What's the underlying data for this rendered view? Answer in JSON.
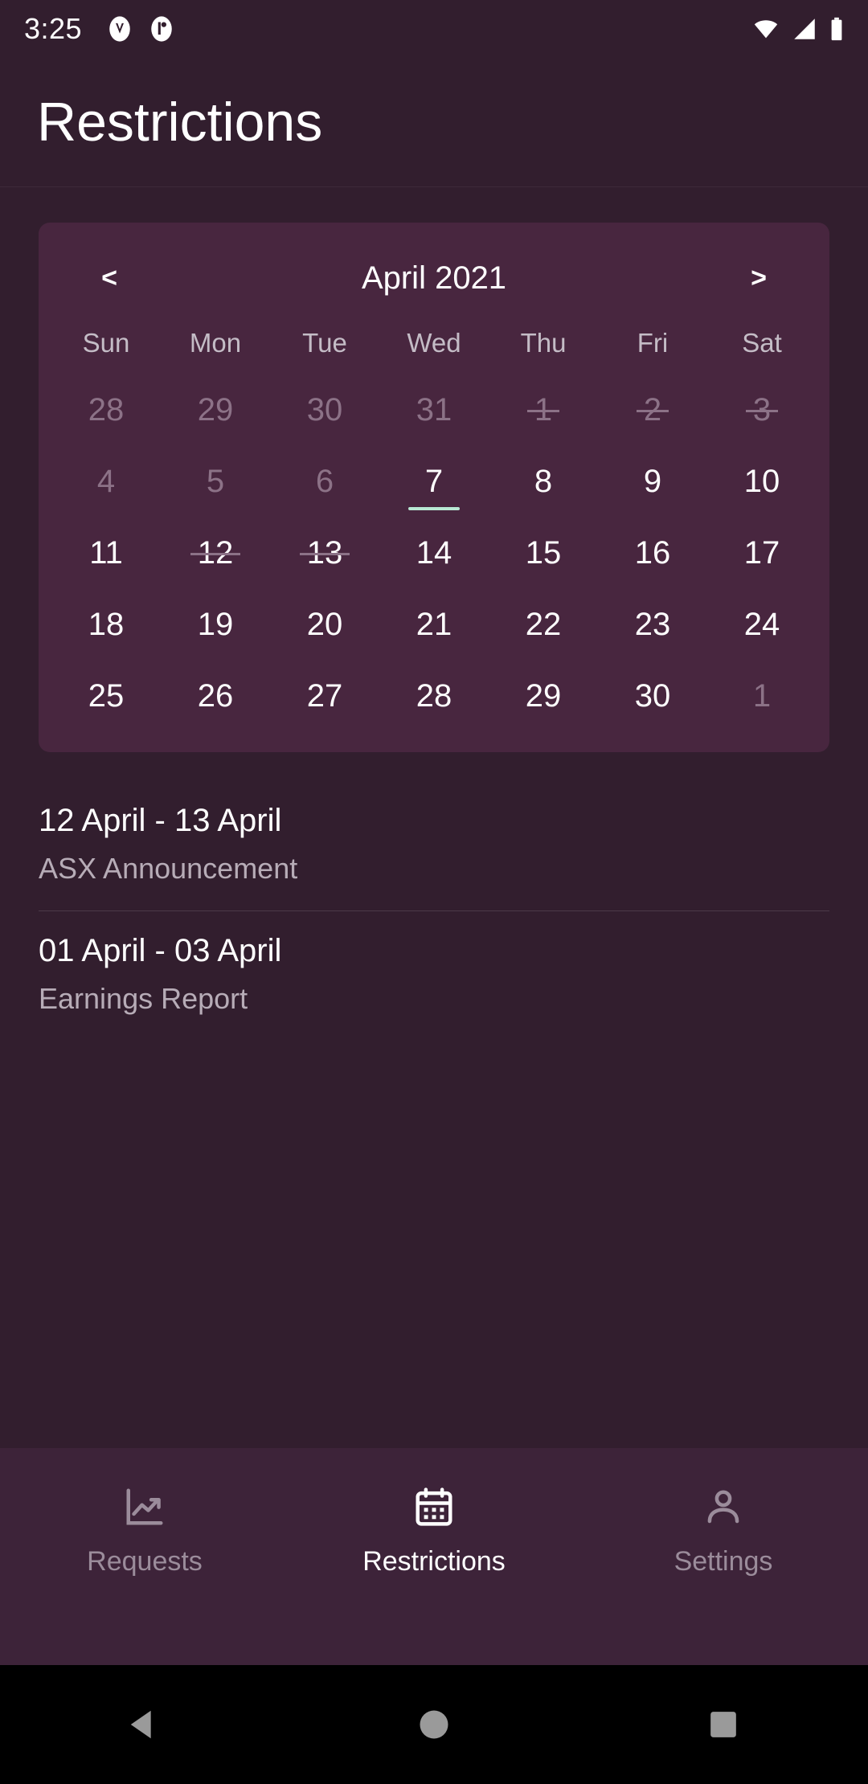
{
  "statusbar": {
    "time": "3:25",
    "notification_icons": [
      "app-badge-icon",
      "app-badge-icon-2"
    ],
    "wifi_icon": "wifi-icon",
    "signal_icon": "cell-signal-icon",
    "battery_icon": "battery-full-icon"
  },
  "header": {
    "title": "Restrictions"
  },
  "calendar": {
    "prev_label": "<",
    "next_label": ">",
    "month_title": "April 2021",
    "weekdays": [
      "Sun",
      "Mon",
      "Tue",
      "Wed",
      "Thu",
      "Fri",
      "Sat"
    ],
    "weeks": [
      [
        {
          "label": "28",
          "state": "other-month"
        },
        {
          "label": "29",
          "state": "other-month"
        },
        {
          "label": "30",
          "state": "other-month"
        },
        {
          "label": "31",
          "state": "other-month"
        },
        {
          "label": "1",
          "state": "past-restricted"
        },
        {
          "label": "2",
          "state": "past-restricted"
        },
        {
          "label": "3",
          "state": "past-restricted"
        }
      ],
      [
        {
          "label": "4",
          "state": "past"
        },
        {
          "label": "5",
          "state": "past"
        },
        {
          "label": "6",
          "state": "past"
        },
        {
          "label": "7",
          "state": "today"
        },
        {
          "label": "8",
          "state": "normal"
        },
        {
          "label": "9",
          "state": "normal"
        },
        {
          "label": "10",
          "state": "normal"
        }
      ],
      [
        {
          "label": "11",
          "state": "normal"
        },
        {
          "label": "12",
          "state": "restricted"
        },
        {
          "label": "13",
          "state": "restricted"
        },
        {
          "label": "14",
          "state": "normal"
        },
        {
          "label": "15",
          "state": "normal"
        },
        {
          "label": "16",
          "state": "normal"
        },
        {
          "label": "17",
          "state": "normal"
        }
      ],
      [
        {
          "label": "18",
          "state": "normal"
        },
        {
          "label": "19",
          "state": "normal"
        },
        {
          "label": "20",
          "state": "normal"
        },
        {
          "label": "21",
          "state": "normal"
        },
        {
          "label": "22",
          "state": "normal"
        },
        {
          "label": "23",
          "state": "normal"
        },
        {
          "label": "24",
          "state": "normal"
        }
      ],
      [
        {
          "label": "25",
          "state": "normal"
        },
        {
          "label": "26",
          "state": "normal"
        },
        {
          "label": "27",
          "state": "normal"
        },
        {
          "label": "28",
          "state": "normal"
        },
        {
          "label": "29",
          "state": "normal"
        },
        {
          "label": "30",
          "state": "normal"
        },
        {
          "label": "1",
          "state": "other-month"
        }
      ]
    ]
  },
  "restrictions": [
    {
      "range": "12 April - 13 April",
      "reason": "ASX Announcement"
    },
    {
      "range": "01 April - 03 April",
      "reason": "Earnings Report"
    }
  ],
  "bottom_nav": {
    "items": [
      {
        "label": "Requests",
        "icon": "chart-line-up-icon",
        "active": false
      },
      {
        "label": "Restrictions",
        "icon": "calendar-icon",
        "active": true
      },
      {
        "label": "Settings",
        "icon": "person-icon",
        "active": false
      }
    ]
  },
  "system_nav": {
    "back": "back-triangle-icon",
    "home": "home-circle-icon",
    "recents": "recents-square-icon"
  },
  "colors": {
    "background": "#321e2e",
    "card": "#48263f",
    "bottom_nav": "#3d2339",
    "accent_underline": "#b9e8d4",
    "text_primary": "#ffffff",
    "text_muted": "#8c7287",
    "text_secondary": "#b7acb7"
  }
}
